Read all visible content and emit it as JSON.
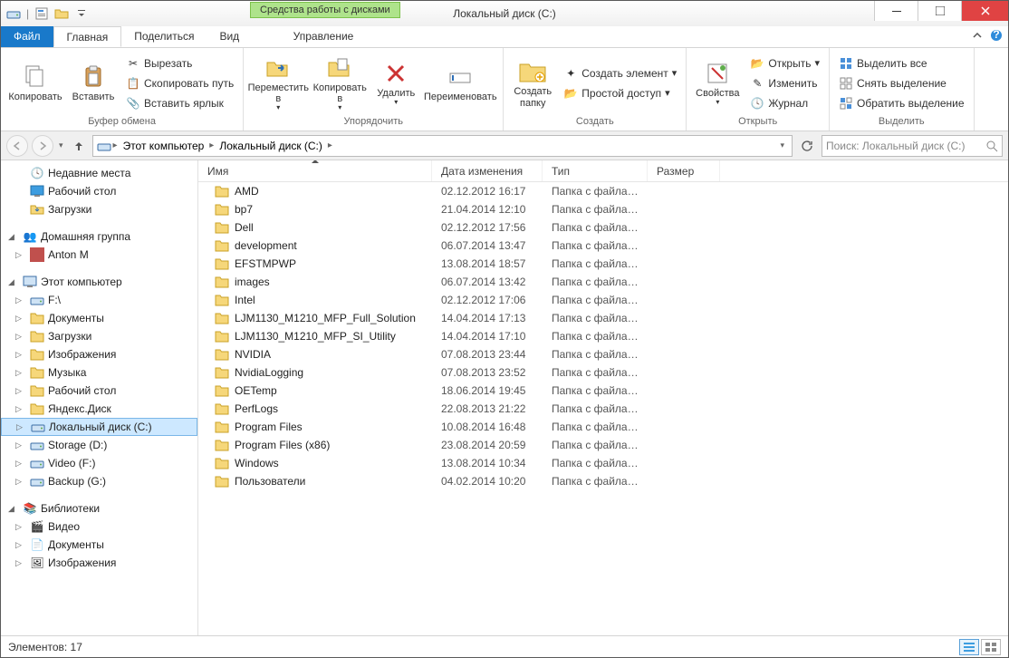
{
  "window": {
    "title": "Локальный диск (C:)",
    "context_tab": "Средства работы с дисками"
  },
  "tabs": {
    "file": "Файл",
    "home": "Главная",
    "share": "Поделиться",
    "view": "Вид",
    "manage": "Управление"
  },
  "ribbon": {
    "clipboard": {
      "title": "Буфер обмена",
      "copy": "Копировать",
      "paste": "Вставить",
      "cut": "Вырезать",
      "copy_path": "Скопировать путь",
      "paste_shortcut": "Вставить ярлык"
    },
    "organize": {
      "title": "Упорядочить",
      "move_to": "Переместить в",
      "copy_to": "Копировать в",
      "delete": "Удалить",
      "rename": "Переименовать"
    },
    "new": {
      "title": "Создать",
      "new_folder": "Создать папку",
      "new_item": "Создать элемент",
      "easy_access": "Простой доступ"
    },
    "open": {
      "title": "Открыть",
      "properties": "Свойства",
      "open": "Открыть",
      "edit": "Изменить",
      "history": "Журнал"
    },
    "select": {
      "title": "Выделить",
      "select_all": "Выделить все",
      "select_none": "Снять выделение",
      "invert": "Обратить выделение"
    }
  },
  "breadcrumb": {
    "root": "Этот компьютер",
    "current": "Локальный диск (C:)"
  },
  "search": {
    "placeholder": "Поиск: Локальный диск (C:)"
  },
  "sidebar": {
    "recent": "Недавние места",
    "desktop": "Рабочий стол",
    "downloads": "Загрузки",
    "homegroup": "Домашняя группа",
    "user": "Anton M",
    "this_pc": "Этот компьютер",
    "drives": [
      {
        "label": "F:\\"
      },
      {
        "label": "Документы"
      },
      {
        "label": "Загрузки"
      },
      {
        "label": "Изображения"
      },
      {
        "label": "Музыка"
      },
      {
        "label": "Рабочий стол"
      },
      {
        "label": "Яндекс.Диск"
      },
      {
        "label": "Локальный диск (C:)",
        "selected": true
      },
      {
        "label": "Storage (D:)"
      },
      {
        "label": "Video (F:)"
      },
      {
        "label": "Backup (G:)"
      }
    ],
    "libraries": "Библиотеки",
    "libs": [
      {
        "label": "Видео"
      },
      {
        "label": "Документы"
      },
      {
        "label": "Изображения"
      }
    ]
  },
  "columns": {
    "name": "Имя",
    "date": "Дата изменения",
    "type": "Тип",
    "size": "Размер"
  },
  "files": [
    {
      "name": "AMD",
      "date": "02.12.2012 16:17",
      "type": "Папка с файлами"
    },
    {
      "name": "bp7",
      "date": "21.04.2014 12:10",
      "type": "Папка с файлами"
    },
    {
      "name": "Dell",
      "date": "02.12.2012 17:56",
      "type": "Папка с файлами"
    },
    {
      "name": "development",
      "date": "06.07.2014 13:47",
      "type": "Папка с файлами"
    },
    {
      "name": "EFSTMPWP",
      "date": "13.08.2014 18:57",
      "type": "Папка с файлами"
    },
    {
      "name": "images",
      "date": "06.07.2014 13:42",
      "type": "Папка с файлами"
    },
    {
      "name": "Intel",
      "date": "02.12.2012 17:06",
      "type": "Папка с файлами"
    },
    {
      "name": "LJM1130_M1210_MFP_Full_Solution",
      "date": "14.04.2014 17:13",
      "type": "Папка с файлами"
    },
    {
      "name": "LJM1130_M1210_MFP_SI_Utility",
      "date": "14.04.2014 17:10",
      "type": "Папка с файлами"
    },
    {
      "name": "NVIDIA",
      "date": "07.08.2013 23:44",
      "type": "Папка с файлами"
    },
    {
      "name": "NvidiaLogging",
      "date": "07.08.2013 23:52",
      "type": "Папка с файлами"
    },
    {
      "name": "OETemp",
      "date": "18.06.2014 19:45",
      "type": "Папка с файлами"
    },
    {
      "name": "PerfLogs",
      "date": "22.08.2013 21:22",
      "type": "Папка с файлами"
    },
    {
      "name": "Program Files",
      "date": "10.08.2014 16:48",
      "type": "Папка с файлами"
    },
    {
      "name": "Program Files (x86)",
      "date": "23.08.2014 20:59",
      "type": "Папка с файлами"
    },
    {
      "name": "Windows",
      "date": "13.08.2014 10:34",
      "type": "Папка с файлами"
    },
    {
      "name": "Пользователи",
      "date": "04.02.2014 10:20",
      "type": "Папка с файлами"
    }
  ],
  "status": {
    "items_label": "Элементов:",
    "count": "17"
  }
}
